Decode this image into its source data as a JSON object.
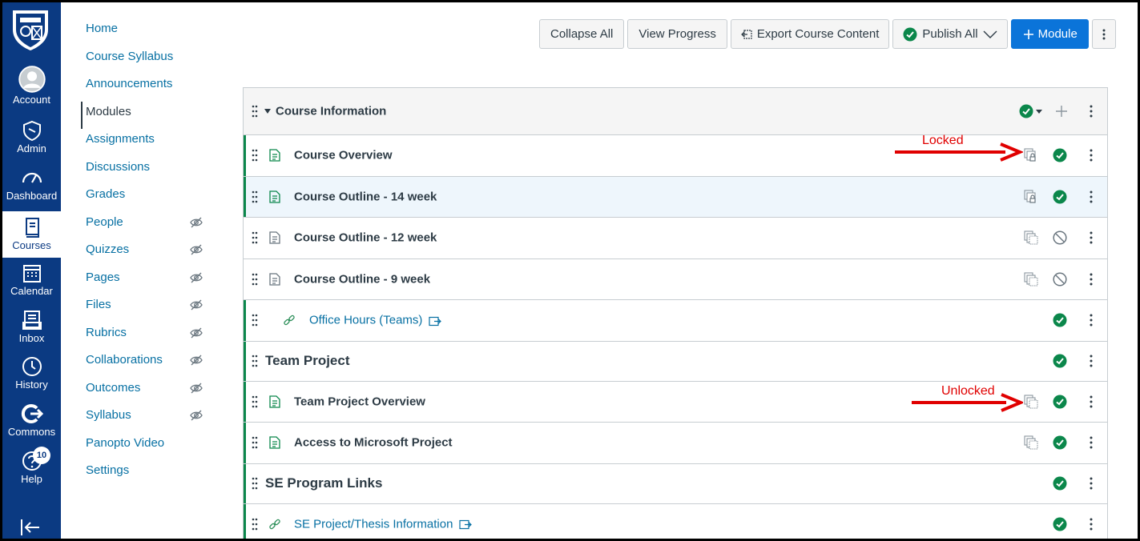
{
  "global_nav": {
    "items": [
      {
        "label": "Account",
        "icon": "account-icon"
      },
      {
        "label": "Admin",
        "icon": "admin-icon"
      },
      {
        "label": "Dashboard",
        "icon": "dashboard-icon"
      },
      {
        "label": "Courses",
        "icon": "courses-icon",
        "active": true
      },
      {
        "label": "Calendar",
        "icon": "calendar-icon"
      },
      {
        "label": "Inbox",
        "icon": "inbox-icon"
      },
      {
        "label": "History",
        "icon": "history-icon"
      },
      {
        "label": "Commons",
        "icon": "commons-icon"
      },
      {
        "label": "Help",
        "icon": "help-icon",
        "badge": "10"
      }
    ],
    "brand_color": "#0b3a82"
  },
  "course_nav": {
    "items": [
      {
        "label": "Home"
      },
      {
        "label": "Course Syllabus"
      },
      {
        "label": "Announcements"
      },
      {
        "label": "Modules",
        "active": true
      },
      {
        "label": "Assignments"
      },
      {
        "label": "Discussions"
      },
      {
        "label": "Grades"
      },
      {
        "label": "People",
        "hidden": true
      },
      {
        "label": "Quizzes",
        "hidden": true
      },
      {
        "label": "Pages",
        "hidden": true
      },
      {
        "label": "Files",
        "hidden": true
      },
      {
        "label": "Rubrics",
        "hidden": true
      },
      {
        "label": "Collaborations",
        "hidden": true
      },
      {
        "label": "Outcomes",
        "hidden": true
      },
      {
        "label": "Syllabus",
        "hidden": true
      },
      {
        "label": "Panopto Video"
      },
      {
        "label": "Settings"
      }
    ]
  },
  "toolbar": {
    "collapse_all": "Collapse All",
    "view_progress": "View Progress",
    "export": "Export Course Content",
    "publish_all": "Publish All",
    "add_module": "Module"
  },
  "module": {
    "title": "Course Information",
    "items": [
      {
        "title": "Course Overview",
        "type": "page",
        "lock": "locked",
        "status": "published"
      },
      {
        "title": "Course Outline - 14 week",
        "type": "page",
        "lock": "locked",
        "status": "published"
      },
      {
        "title": "Course Outline - 12 week",
        "type": "page",
        "lock": "unlocked",
        "status": "unpublished"
      },
      {
        "title": "Course Outline - 9 week",
        "type": "page",
        "lock": "unlocked",
        "status": "unpublished"
      },
      {
        "title": "Office Hours (Teams)",
        "type": "link",
        "status": "published"
      },
      {
        "title": "Team Project",
        "type": "subheader",
        "status": "published"
      },
      {
        "title": "Team Project Overview",
        "type": "page",
        "lock": "unlocked",
        "status": "published"
      },
      {
        "title": "Access to Microsoft Project",
        "type": "page",
        "lock": "unlocked",
        "status": "published"
      },
      {
        "title": "SE Program Links",
        "type": "subheader",
        "status": "published"
      },
      {
        "title": "SE Project/Thesis Information",
        "type": "link",
        "status": "published"
      }
    ]
  },
  "annotations": {
    "locked": "Locked",
    "unlocked": "Unlocked"
  },
  "colors": {
    "published_green": "#0b874b",
    "link_blue": "#0770a3",
    "primary_button": "#0b74d9",
    "annotation_red": "#e00000"
  }
}
